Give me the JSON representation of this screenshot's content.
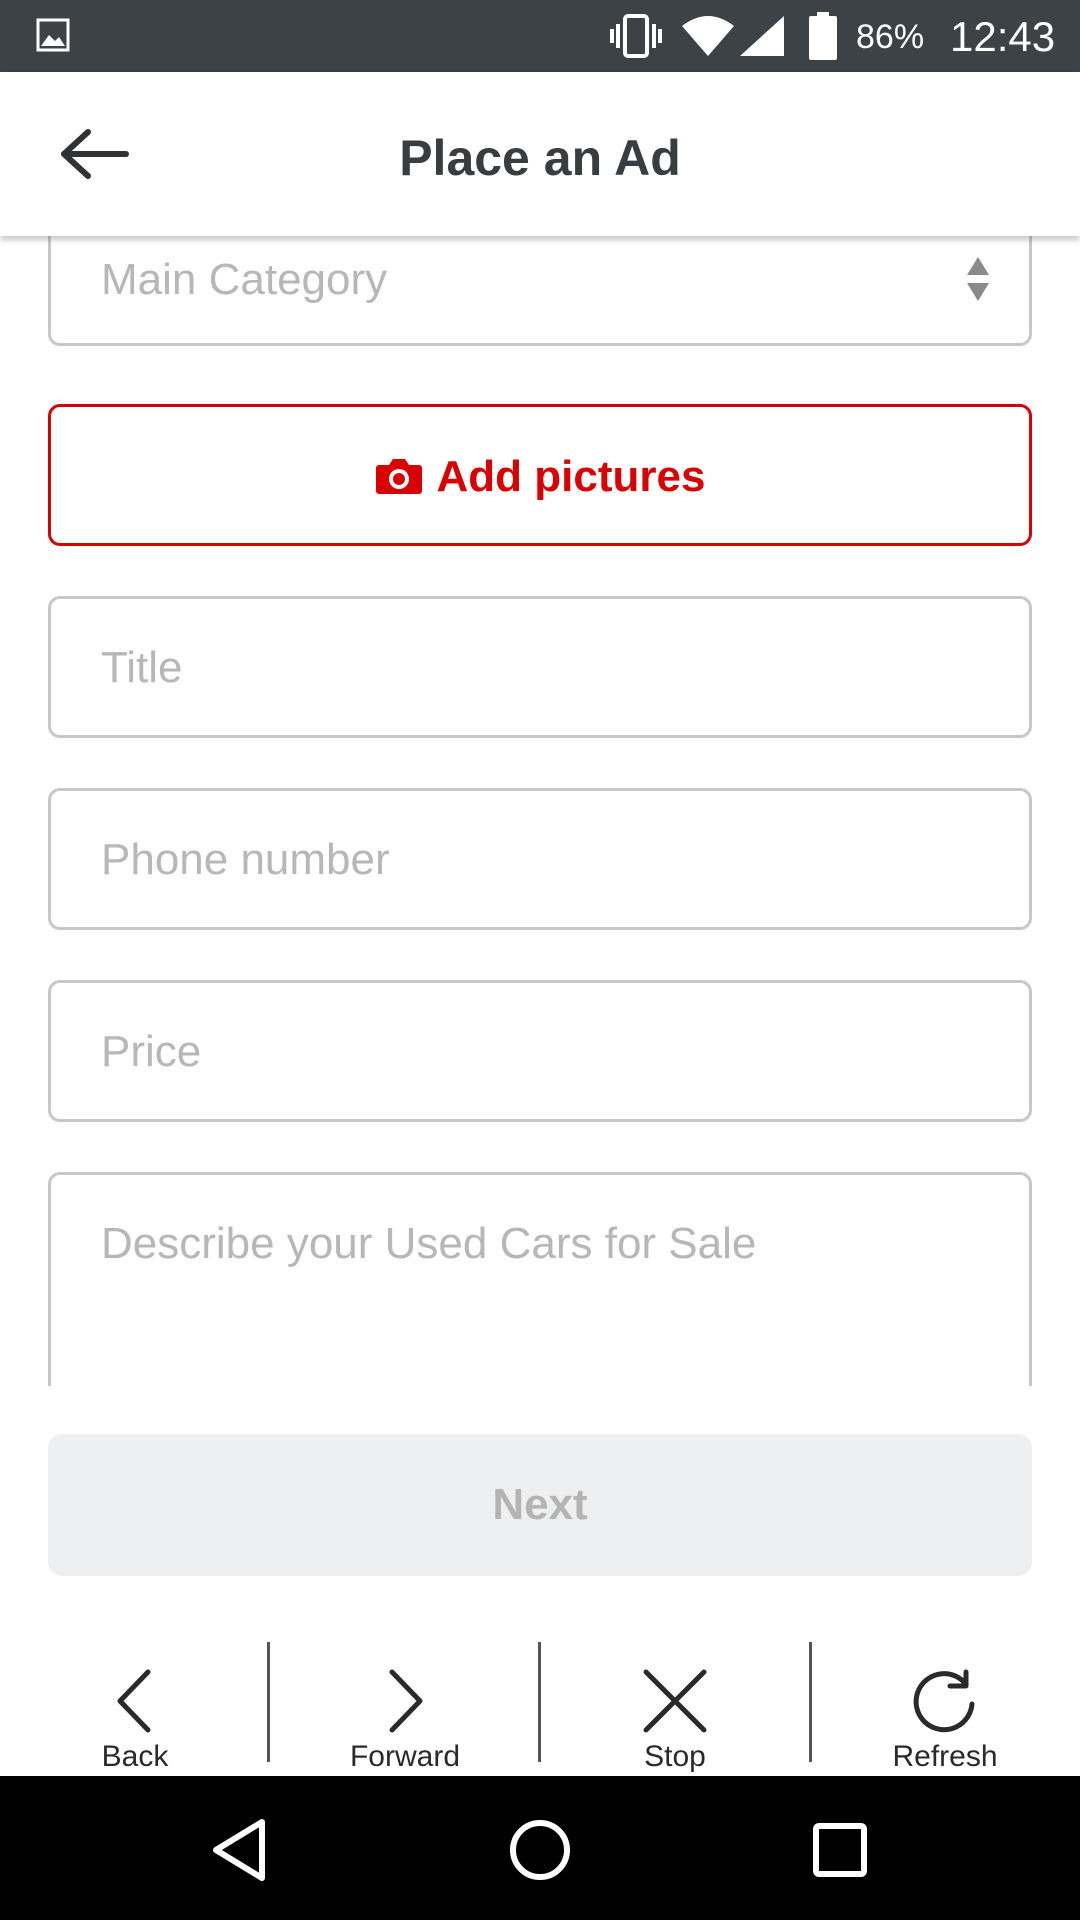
{
  "status_bar": {
    "battery": "86%",
    "time": "12:43",
    "icons": [
      "gallery-icon",
      "vibrate-icon",
      "wifi-icon",
      "signal-icon",
      "battery-icon"
    ]
  },
  "app_bar": {
    "title": "Place an Ad",
    "back_icon": "arrow-left-icon"
  },
  "form": {
    "main_category_placeholder": "Main Category",
    "add_pictures_label": "Add pictures",
    "title_placeholder": "Title",
    "phone_placeholder": "Phone number",
    "price_placeholder": "Price",
    "description_placeholder": "Describe your Used Cars for Sale",
    "next_label": "Next"
  },
  "browser_toolbar": {
    "back": "Back",
    "forward": "Forward",
    "stop": "Stop",
    "refresh": "Refresh"
  },
  "colors": {
    "accent": "#d80000",
    "status_bar": "#3c4246",
    "disabled_button_bg": "#eeeff0",
    "title_text": "#3a3d40"
  }
}
